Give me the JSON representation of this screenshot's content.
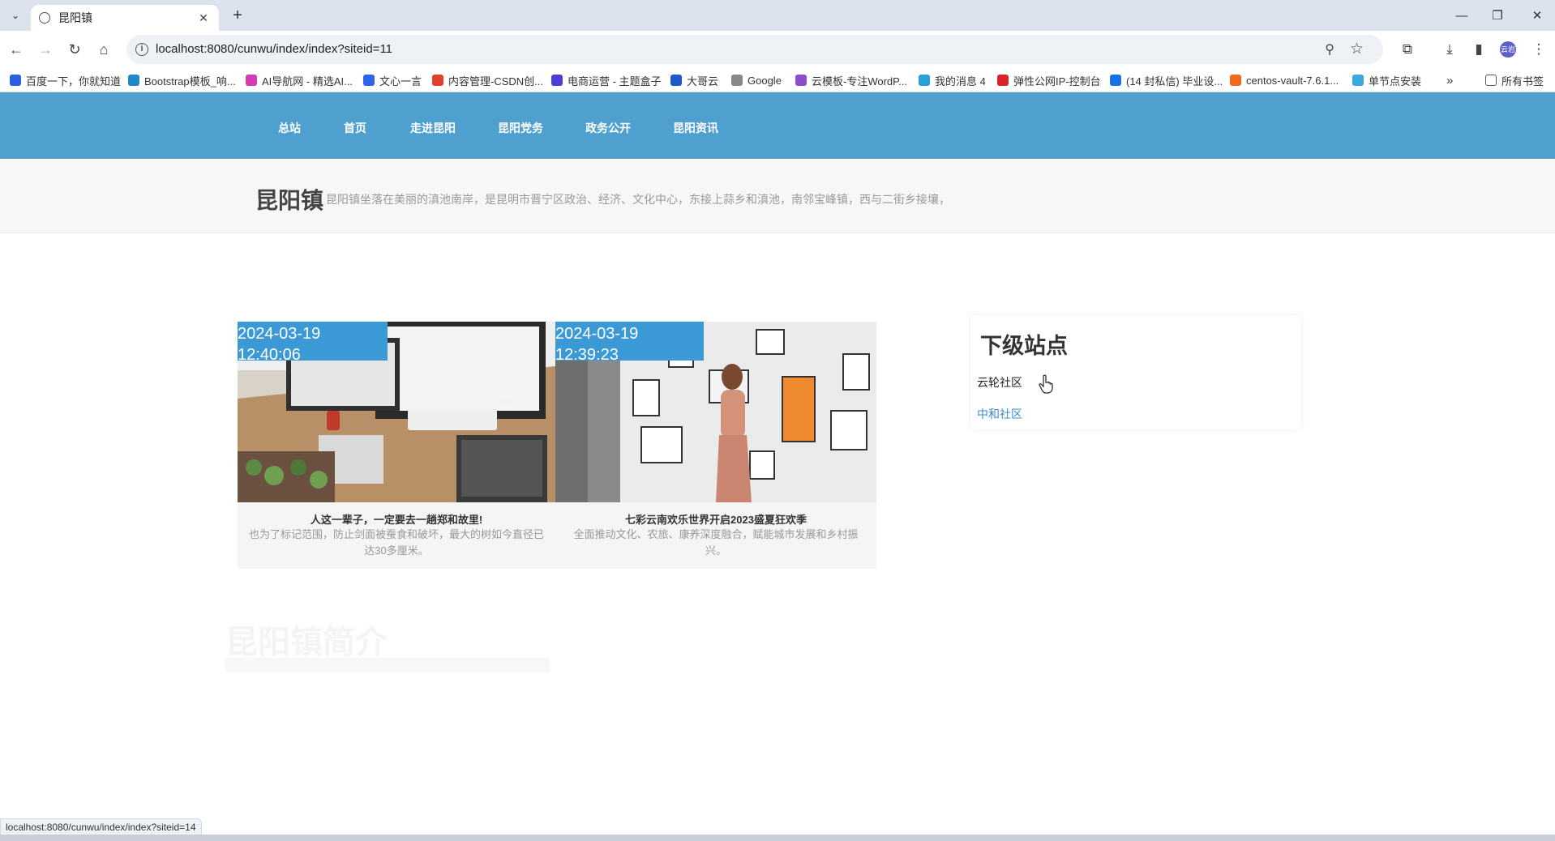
{
  "browser": {
    "tab_title": "昆阳镇",
    "url": "localhost:8080/cunwu/index/index?siteid=11",
    "profile_label": "云岩",
    "status_url": "localhost:8080/cunwu/index/index?siteid=14",
    "bookmarks": [
      {
        "label": "百度一下，你就知道",
        "icon": "paw-icon",
        "color": "#2b5fe0"
      },
      {
        "label": "Bootstrap模板_响...",
        "icon": "bootstrap-icon",
        "color": "#1e88c8"
      },
      {
        "label": "AI导航网 - 精选AI...",
        "icon": "ai-nav-icon",
        "color": "#d43ab5"
      },
      {
        "label": "文心一言",
        "icon": "wenxin-icon",
        "color": "#2c65e8"
      },
      {
        "label": "内容管理-CSDN创...",
        "icon": "csdn-icon",
        "color": "#e0432a"
      },
      {
        "label": "电商运营 - 主题盒子",
        "icon": "theme-box-icon",
        "color": "#4b3fd1"
      },
      {
        "label": "大哥云",
        "icon": "dagecloud-icon",
        "color": "#1f59c9"
      },
      {
        "label": "Google",
        "icon": "google-icon",
        "color": "#888888"
      },
      {
        "label": "云模板-专注WordP...",
        "icon": "cloud-template-icon",
        "color": "#8b4fc9"
      },
      {
        "label": "我的消息 4",
        "icon": "bilibili-icon",
        "color": "#2aa0d8"
      },
      {
        "label": "弹性公网IP-控制台",
        "icon": "huawei-icon",
        "color": "#d9232a"
      },
      {
        "label": "(14 封私信) 毕业设...",
        "icon": "zhihu-icon",
        "color": "#1771e6"
      },
      {
        "label": "centos-vault-7.6.1...",
        "icon": "aliyun-icon",
        "color": "#f06a1a"
      },
      {
        "label": "单节点安装",
        "icon": "layers-icon",
        "color": "#3ba9e0"
      }
    ],
    "all_bookmarks_label": "所有书签"
  },
  "site": {
    "nav": [
      "总站",
      "首页",
      "走进昆阳",
      "昆阳党务",
      "政务公开",
      "昆阳资讯"
    ],
    "name": "昆阳镇",
    "description": "昆阳镇坐落在美丽的滇池南岸，是昆明市晋宁区政治、经济、文化中心，东接上蒜乡和滇池，南邻宝峰镇，西与二街乡接壤，",
    "cards": [
      {
        "timestamp": "2024-03-19 12:40:06",
        "title": "人这一辈子，一定要去一趟郑和故里!",
        "desc": "也为了标记范围，防止剑面被蚕食和破坏，最大的树如今直径已达30多厘米。"
      },
      {
        "timestamp": "2024-03-19 12:39:23",
        "title": "七彩云南欢乐世界开启2023盛夏狂欢季",
        "desc": "全面推动文化、农旅、康养深度融合，赋能城市发展和乡村振兴。"
      }
    ],
    "sub_sites": {
      "heading": "下级站点",
      "items": [
        "云轮社区",
        "中和社区"
      ]
    },
    "faded_heading": "昆阳镇简介"
  }
}
